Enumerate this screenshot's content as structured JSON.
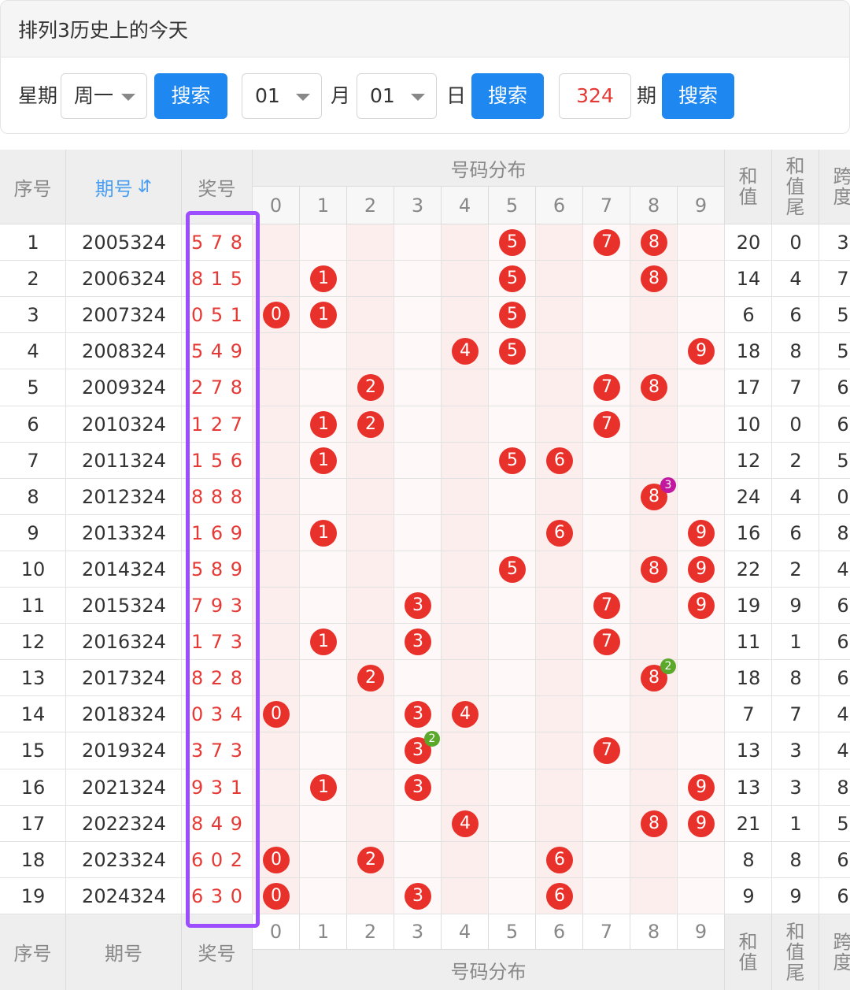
{
  "page_title": "排列3历史上的今天",
  "controls": {
    "weekday_label": "星期",
    "weekday_value": "周一",
    "search_label": "搜索",
    "month_value": "01",
    "month_label": "月",
    "day_value": "01",
    "day_label": "日",
    "period_value": "324",
    "period_label": "期"
  },
  "table": {
    "head": {
      "seq": "序号",
      "period": "期号",
      "sort_icon": "⇵",
      "prize": "奖号",
      "distribution": "号码分布",
      "sum": "和值",
      "sum_tail": "和值尾",
      "span": "跨度",
      "digits": [
        "0",
        "1",
        "2",
        "3",
        "4",
        "5",
        "6",
        "7",
        "8",
        "9"
      ]
    },
    "rows": [
      {
        "seq": "1",
        "period": "2005324",
        "prize": "5 7 8",
        "digits": [
          5,
          7,
          8
        ],
        "sum": "20",
        "tail": "0",
        "span": "3"
      },
      {
        "seq": "2",
        "period": "2006324",
        "prize": "8 1 5",
        "digits": [
          8,
          1,
          5
        ],
        "sum": "14",
        "tail": "4",
        "span": "7"
      },
      {
        "seq": "3",
        "period": "2007324",
        "prize": "0 5 1",
        "digits": [
          0,
          5,
          1
        ],
        "sum": "6",
        "tail": "6",
        "span": "5"
      },
      {
        "seq": "4",
        "period": "2008324",
        "prize": "5 4 9",
        "digits": [
          5,
          4,
          9
        ],
        "sum": "18",
        "tail": "8",
        "span": "5"
      },
      {
        "seq": "5",
        "period": "2009324",
        "prize": "2 7 8",
        "digits": [
          2,
          7,
          8
        ],
        "sum": "17",
        "tail": "7",
        "span": "6"
      },
      {
        "seq": "6",
        "period": "2010324",
        "prize": "1 2 7",
        "digits": [
          1,
          2,
          7
        ],
        "sum": "10",
        "tail": "0",
        "span": "6"
      },
      {
        "seq": "7",
        "period": "2011324",
        "prize": "1 5 6",
        "digits": [
          1,
          5,
          6
        ],
        "sum": "12",
        "tail": "2",
        "span": "5"
      },
      {
        "seq": "8",
        "period": "2012324",
        "prize": "8 8 8",
        "digits": [
          8,
          8,
          8
        ],
        "sum": "24",
        "tail": "4",
        "span": "0",
        "repeat": {
          "digit": 8,
          "count": "3",
          "color": "#c2189f"
        }
      },
      {
        "seq": "9",
        "period": "2013324",
        "prize": "1 6 9",
        "digits": [
          1,
          6,
          9
        ],
        "sum": "16",
        "tail": "6",
        "span": "8"
      },
      {
        "seq": "10",
        "period": "2014324",
        "prize": "5 8 9",
        "digits": [
          5,
          8,
          9
        ],
        "sum": "22",
        "tail": "2",
        "span": "4"
      },
      {
        "seq": "11",
        "period": "2015324",
        "prize": "7 9 3",
        "digits": [
          7,
          9,
          3
        ],
        "sum": "19",
        "tail": "9",
        "span": "6"
      },
      {
        "seq": "12",
        "period": "2016324",
        "prize": "1 7 3",
        "digits": [
          1,
          7,
          3
        ],
        "sum": "11",
        "tail": "1",
        "span": "6"
      },
      {
        "seq": "13",
        "period": "2017324",
        "prize": "8 2 8",
        "digits": [
          8,
          2,
          8
        ],
        "sum": "18",
        "tail": "8",
        "span": "6",
        "repeat": {
          "digit": 8,
          "count": "2",
          "color": "#5aa92a"
        }
      },
      {
        "seq": "14",
        "period": "2018324",
        "prize": "0 3 4",
        "digits": [
          0,
          3,
          4
        ],
        "sum": "7",
        "tail": "7",
        "span": "4"
      },
      {
        "seq": "15",
        "period": "2019324",
        "prize": "3 7 3",
        "digits": [
          3,
          7,
          3
        ],
        "sum": "13",
        "tail": "3",
        "span": "4",
        "repeat": {
          "digit": 3,
          "count": "2",
          "color": "#5aa92a"
        }
      },
      {
        "seq": "16",
        "period": "2021324",
        "prize": "9 3 1",
        "digits": [
          9,
          3,
          1
        ],
        "sum": "13",
        "tail": "3",
        "span": "8"
      },
      {
        "seq": "17",
        "period": "2022324",
        "prize": "8 4 9",
        "digits": [
          8,
          4,
          9
        ],
        "sum": "21",
        "tail": "1",
        "span": "5"
      },
      {
        "seq": "18",
        "period": "2023324",
        "prize": "6 0 2",
        "digits": [
          6,
          0,
          2
        ],
        "sum": "8",
        "tail": "8",
        "span": "6"
      },
      {
        "seq": "19",
        "period": "2024324",
        "prize": "6 3 0",
        "digits": [
          6,
          3,
          0
        ],
        "sum": "9",
        "tail": "9",
        "span": "6"
      }
    ]
  },
  "colors": {
    "accent": "#1e88f0",
    "ball": "#e8312a",
    "prize_text": "#e53935",
    "highlight": "#9b4dff",
    "stripe_even_col": "#fdeeee",
    "stripe_odd_col": "#fff8f8"
  }
}
